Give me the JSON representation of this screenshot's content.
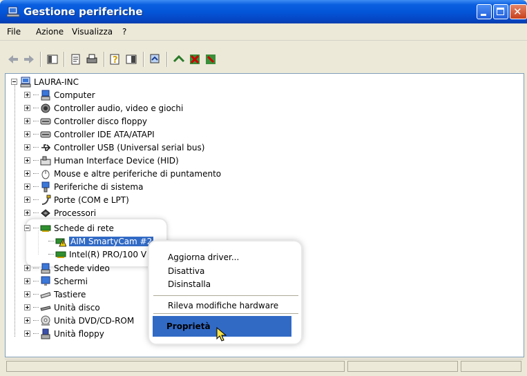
{
  "window": {
    "title": "Gestione periferiche"
  },
  "menu": [
    "File",
    "Azione",
    "Visualizza",
    "?"
  ],
  "tree": {
    "root": "LAURA-INC",
    "items": [
      "Computer",
      "Controller audio, video e giochi",
      "Controller disco floppy",
      "Controller IDE ATA/ATAPI",
      "Controller USB (Universal serial bus)",
      "Human Interface Device (HID)",
      "Mouse e altre periferiche di puntamento",
      "Periferiche di sistema",
      "Porte (COM e LPT)",
      "Processori",
      "Schede di rete",
      "Schede video",
      "Schermi",
      "Tastiere",
      "Unità disco",
      "Unità DVD/CD-ROM",
      "Unità floppy"
    ],
    "network_children": [
      "AIM SmartyCam #2",
      "Intel(R) PRO/100 V"
    ]
  },
  "context_menu": {
    "items": [
      "Aggiorna driver...",
      "Disattiva",
      "Disinstalla",
      "Rileva modifiche hardware",
      "Proprietà"
    ]
  },
  "colors": {
    "selection": "#316ac5",
    "titlebar": "#0354d6"
  }
}
